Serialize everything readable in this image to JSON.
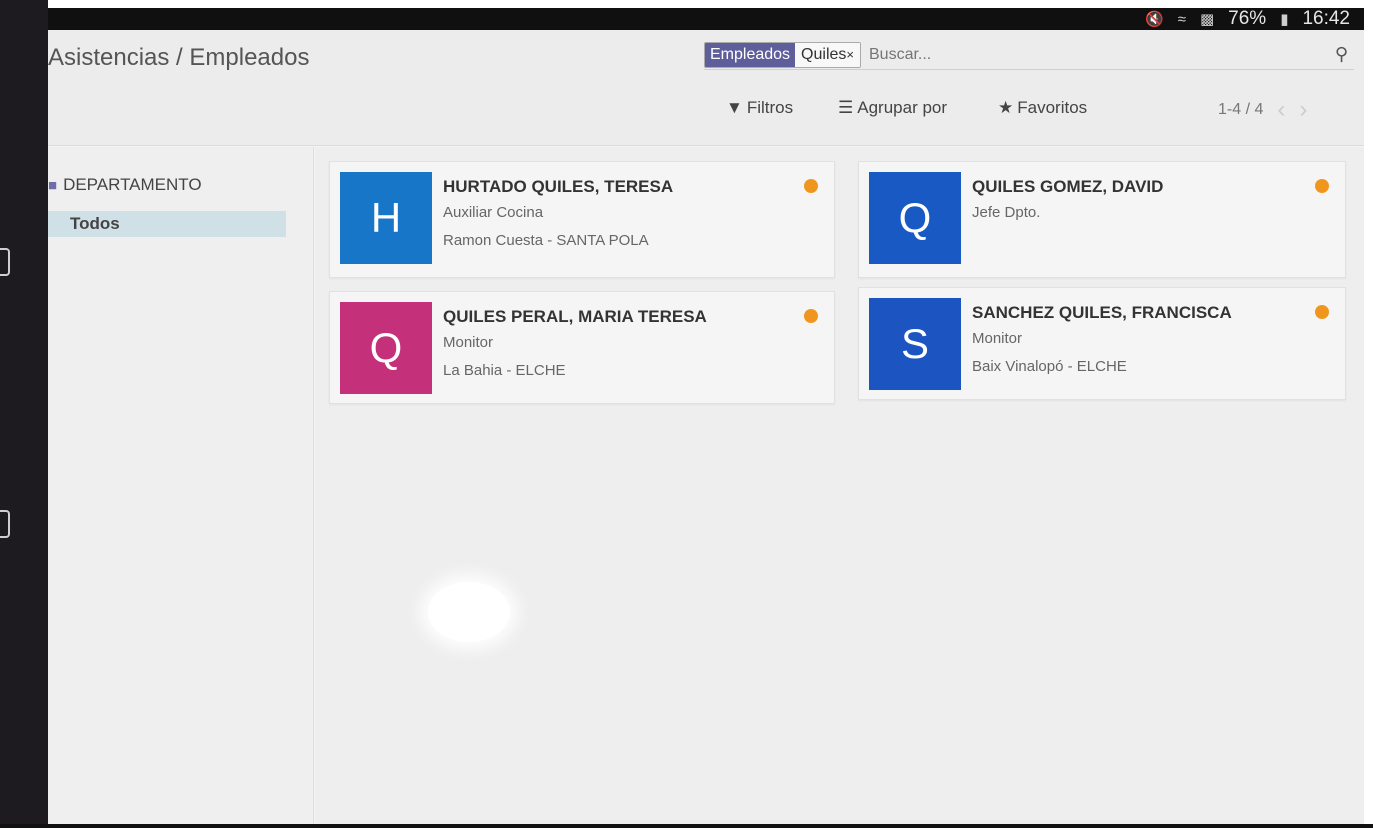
{
  "status_bar": {
    "battery": "76%",
    "time": "16:42"
  },
  "breadcrumb": "Asistencias / Empleados",
  "search": {
    "facet_label": "Empleados",
    "facet_value": "Quiles",
    "placeholder": "Buscar..."
  },
  "toolbar": {
    "filters": "Filtros",
    "group_by": "Agrupar por",
    "favorites": "Favoritos"
  },
  "pager": {
    "range": "1-4 / 4"
  },
  "sidebar": {
    "heading": "DEPARTAMENTO",
    "items": [
      {
        "label": "Todos"
      }
    ]
  },
  "colors": {
    "status_dot": "#f0961e",
    "facet_bg": "#5e5e9b",
    "avatar_h": "#1776c8",
    "avatar_q1": "#1859c4",
    "avatar_q2": "#c4317a",
    "avatar_s": "#1c55c1"
  },
  "employees": [
    {
      "initial": "H",
      "name": "HURTADO QUILES, TERESA",
      "job": "Auxiliar Cocina",
      "place": "Ramon Cuesta - SANTA POLA"
    },
    {
      "initial": "Q",
      "name": "QUILES GOMEZ, DAVID",
      "job": "Jefe Dpto.",
      "place": ""
    },
    {
      "initial": "Q",
      "name": "QUILES PERAL, MARIA TERESA",
      "job": "Monitor",
      "place": "La Bahia - ELCHE"
    },
    {
      "initial": "S",
      "name": "SANCHEZ QUILES, FRANCISCA",
      "job": "Monitor",
      "place": "Baix Vinalopó - ELCHE"
    }
  ]
}
